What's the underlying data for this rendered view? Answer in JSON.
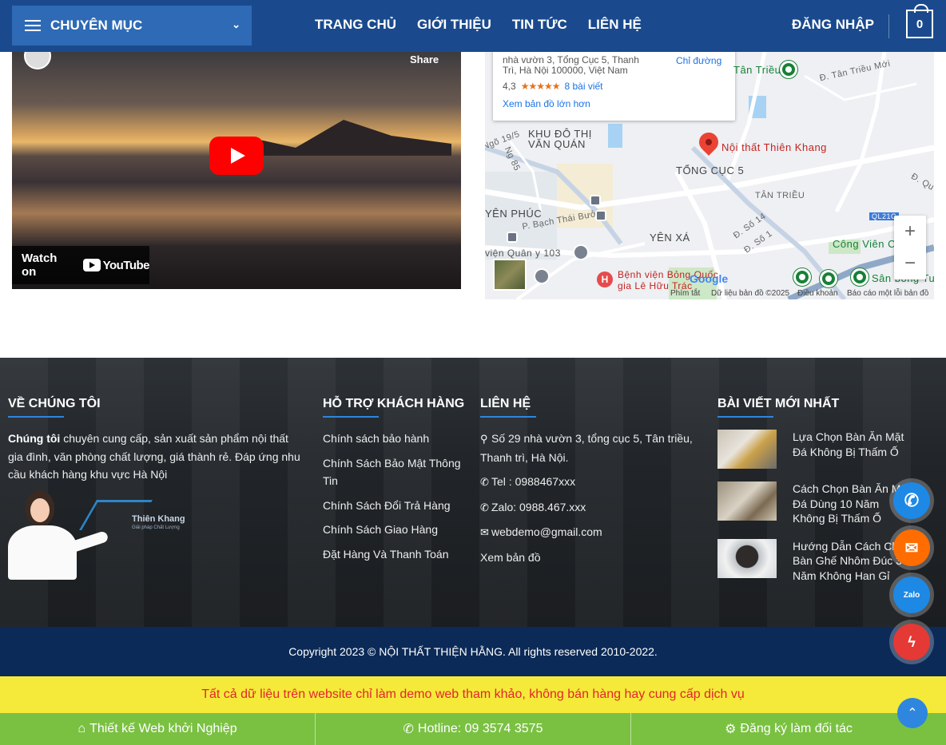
{
  "header": {
    "category_label": "CHUYÊN MỤC",
    "nav": [
      "TRANG CHỦ",
      "GIỚI THIỆU",
      "TIN TỨC",
      "LIÊN HỆ"
    ],
    "login": "ĐĂNG NHẬP",
    "cart_count": "0"
  },
  "video": {
    "share": "Share",
    "watch_on": "Watch on",
    "youtube": "YouTube"
  },
  "map": {
    "address": "nhà vườn 3, Tổng Cục 5, Thanh Trì, Hà Nội 100000, Việt Nam",
    "directions": "Chỉ đường",
    "rating": "4,3",
    "stars": "★★★★★",
    "reviews": "8 bài viết",
    "larger_map": "Xem bản đồ lớn hơn",
    "labels": {
      "tan_trieu_top": "Tân Triều",
      "d_tan_trieu_moi": "Đ. Tân Triều Mới",
      "khu_do_thi": "KHU ĐÔ THỊ",
      "van_quan": "VĂN QUÁN",
      "ng_19_5": "Ngõ 19/5",
      "ng_85": "Ng 85",
      "place": "Nội thất Thiên Khang",
      "tong_cuc_5": "TỔNG CỤC 5",
      "tan_trieu": "TÂN TRIỀU",
      "d_qu": "Đ. Qu",
      "yen_phuc": "YÊN PHÚC",
      "bach_thai_buoi": "P. Bạch Thái Bưởi",
      "ql21c": "QL21C",
      "yen_xa": "YÊN XÁ",
      "d_so_14": "Đ. Số 14",
      "d_so_1": "Đ. Số 1",
      "cong_vien": "Công Viên Ch",
      "vien_quan_y": "viện Quân y 103",
      "benh_vien": "Bệnh viện Bỏng Quốc",
      "le_huu_trac": "gia Lê Hữu Trác",
      "san_bong": "Sân bóng Tu"
    },
    "google": "Google",
    "attribution": [
      "Phím tắt",
      "Dữ liệu bản đồ ©2025",
      "Điều khoản",
      "Báo cáo một lỗi bản đồ"
    ]
  },
  "footer": {
    "about": {
      "title": "VỀ CHÚNG TÔI",
      "strong": "Chúng tôi",
      "text": " chuyên cung cấp, sản xuất sản phẩm nội thất gia đình, văn phòng chất lượng, giá thành rẻ. Đáp ứng nhu cầu khách hàng khu vực Hà Nội",
      "logo_name": "Thiên Khang",
      "logo_tag": "Giải pháp Chất Lượng"
    },
    "support": {
      "title": "HỖ TRỢ KHÁCH HÀNG",
      "links": [
        "Chính sách bảo hành",
        "Chính Sách Bảo Mật Thông Tin",
        "Chính Sách Đổi Trả Hàng",
        "Chính Sách Giao Hàng",
        "Đặt Hàng Và Thanh Toán"
      ]
    },
    "contact": {
      "title": "LIÊN HỆ",
      "address": "Số 29 nhà vườn 3, tổng cục 5, Tân triều, Thanh trì, Hà Nội.",
      "tel": "Tel : 0988467xxx",
      "zalo": "Zalo: 0988.467.xxx",
      "email": "webdemo@gmail.com",
      "map_link": "Xem bản đồ"
    },
    "posts": {
      "title": "BÀI VIẾT MỚI NHẤT",
      "items": [
        "Lựa Chọn Bàn Ăn Mặt Đá Không Bị Thấm Ố",
        "Cách Chọn Bàn Ăn Mặt Đá Dùng 10 Năm Không Bị Thấm Ố",
        "Hướng Dẫn Cách Chọn Bàn Ghế Nhôm Đúc 30 Năm Không Han Gỉ"
      ]
    }
  },
  "copyright": "Copyright 2023 © NỘI THẤT THIỆN HẰNG. All rights reserved 2010-2022.",
  "notice": "Tất cả dữ liệu trên website chỉ làm demo web tham khảo, không bán hàng hay cung cấp dịch vụ",
  "bottombar": {
    "design": "Thiết kế Web khởi Nghiệp",
    "hotline": "Hotline: 09 3574 3575",
    "partner": "Đăng ký làm đối tác"
  },
  "floating": {
    "zalo": "Zalo"
  },
  "colors": {
    "header": "#1a4a8d",
    "accent": "#2e86de",
    "copyright_bg": "#0b2a57",
    "notice_bg": "#f5ea3a",
    "notice_text": "#e3262b",
    "bottombar": "#7ac142"
  }
}
